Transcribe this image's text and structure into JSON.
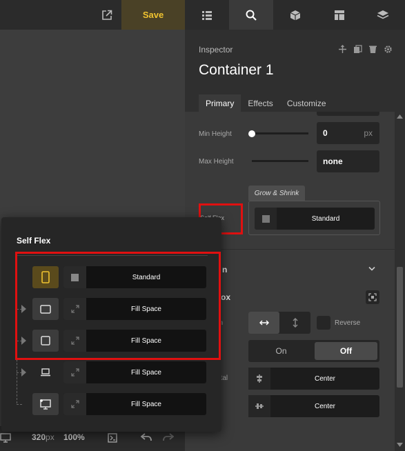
{
  "topbar": {
    "save_label": "Save",
    "icons": [
      "external-link-icon",
      "list-icon",
      "search-icon",
      "cube-icon",
      "layout-icon",
      "layers-icon"
    ]
  },
  "inspector": {
    "label": "Inspector",
    "title": "Container 1",
    "tabs": [
      "Primary",
      "Effects",
      "Customize"
    ],
    "active_tab": "Primary",
    "min_height": {
      "label": "Min Height",
      "value": "0",
      "unit": "px"
    },
    "max_height": {
      "label": "Max Height",
      "value": "none"
    },
    "grow_shrink": {
      "tab_label": "Grow & Shrink",
      "value": "Standard"
    },
    "self_flex_fragment": "Self Flex",
    "section_fragment": "n",
    "section2_fragment": "ox",
    "direction_fragment": "on",
    "reverse_label": "Reverse",
    "wrap": {
      "on": "On",
      "off": "Off",
      "selected": "Off"
    },
    "horizontal_fragment": "ntal",
    "horizontal_value": "Center",
    "vertical_value": "Center"
  },
  "bottom_bar": {
    "width_value": "320",
    "width_unit": "px",
    "zoom": "100%"
  },
  "popup": {
    "title": "Self Flex",
    "rows": [
      {
        "device": "tablet-portrait-icon",
        "option": "Standard",
        "active": true
      },
      {
        "device": "tablet-landscape-icon",
        "option": "Fill Space",
        "active": false
      },
      {
        "device": "square-device-icon",
        "option": "Fill Space",
        "active": false
      },
      {
        "device": "laptop-icon",
        "option": "Fill Space",
        "active": false
      },
      {
        "device": "desktop-icon",
        "option": "Fill Space",
        "active": false
      }
    ]
  },
  "colors": {
    "accent": "#f0c330",
    "highlight": "#e01010"
  }
}
